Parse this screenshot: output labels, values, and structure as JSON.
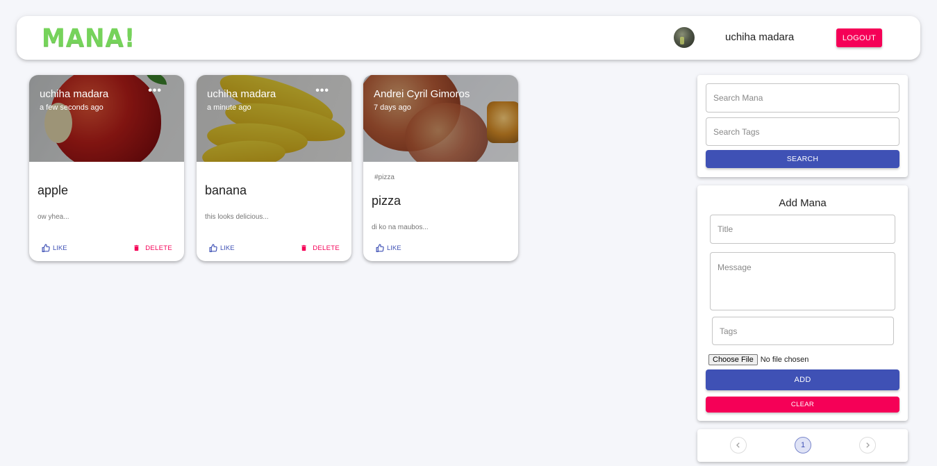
{
  "header": {
    "logo": "MANA!",
    "username": "uchiha madara",
    "logout_label": "LOGOUT"
  },
  "posts": [
    {
      "author": "uchiha madara",
      "time": "a few seconds ago",
      "tags": "",
      "title": "apple",
      "message": "ow yhea...",
      "like_label": "LIKE",
      "delete_label": "DELETE",
      "image": "apple"
    },
    {
      "author": "uchiha madara",
      "time": "a minute ago",
      "tags": "",
      "title": "banana",
      "message": "this looks delicious...",
      "like_label": "LIKE",
      "delete_label": "DELETE",
      "image": "banana"
    },
    {
      "author": "Andrei Cyril Gimoros",
      "time": "7 days ago",
      "tags": "#pizza",
      "title": "pizza",
      "message": "di ko na maubos...",
      "like_label": "LIKE",
      "image": "pizza"
    }
  ],
  "search": {
    "mana_placeholder": "Search Mana",
    "tags_placeholder": "Search Tags",
    "button_label": "SEARCH"
  },
  "form": {
    "title": "Add Mana",
    "title_placeholder": "Title",
    "message_placeholder": "Message",
    "tags_placeholder": "Tags",
    "file_button": "Choose File",
    "file_status": "No file chosen",
    "add_label": "ADD",
    "clear_label": "CLEAR"
  },
  "pagination": {
    "current_page": "1"
  },
  "colors": {
    "primary": "#3f51b5",
    "secondary": "#f50057",
    "logo": "#76d35b",
    "background": "#f5f6fa"
  }
}
